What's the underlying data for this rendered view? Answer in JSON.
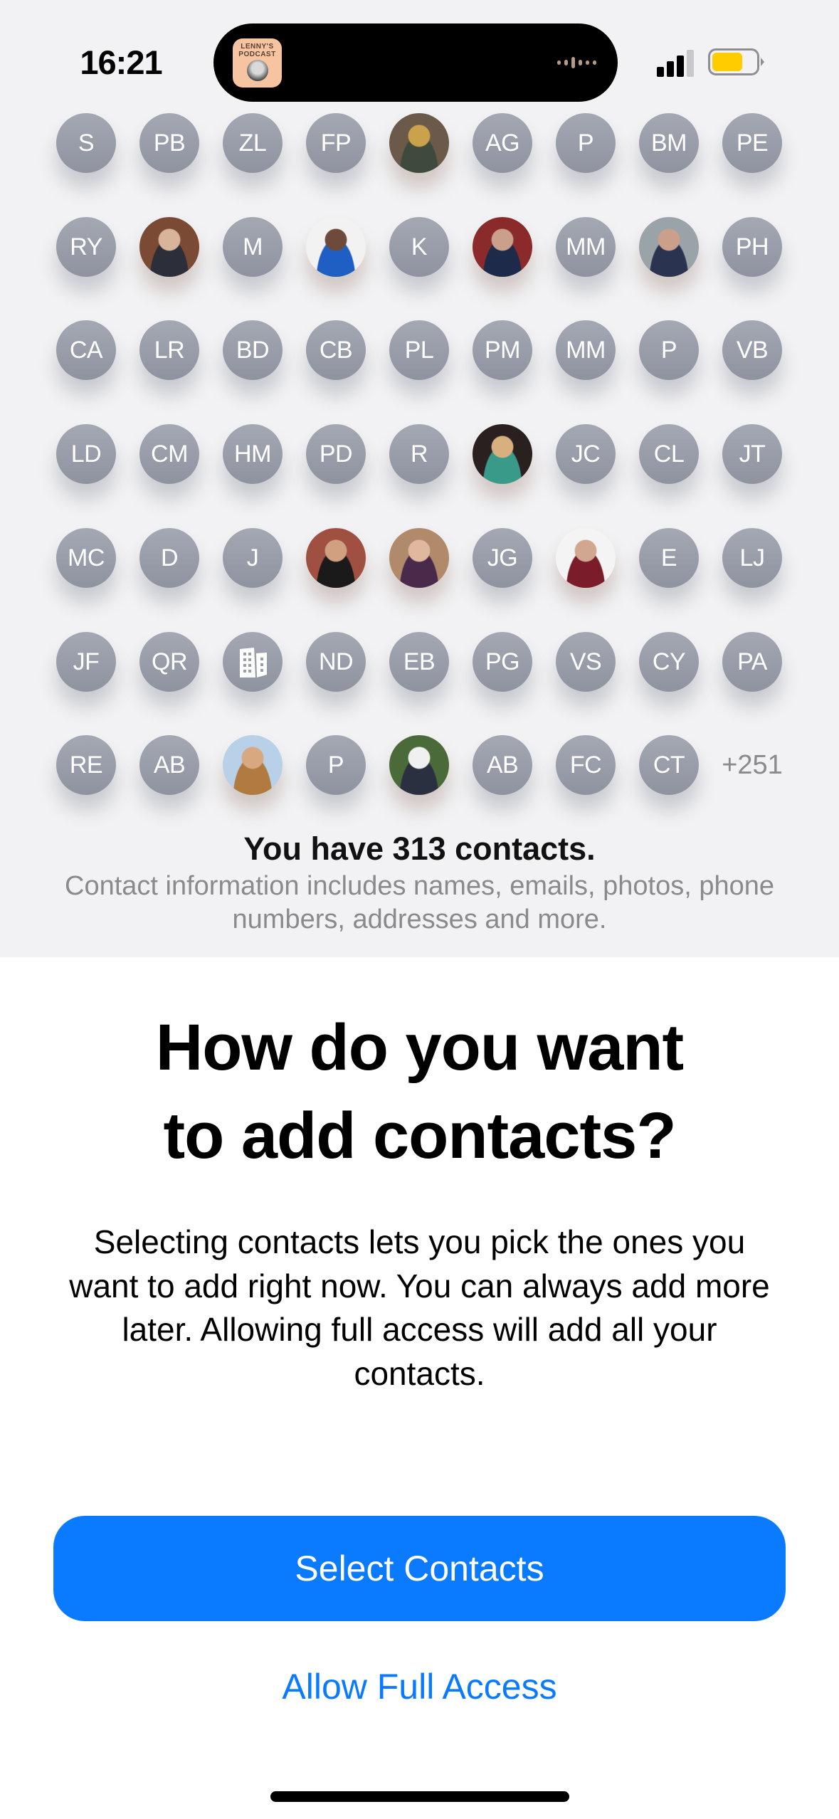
{
  "status_bar": {
    "time": "16:21",
    "now_playing_art_title": "LENNY'S PODCAST",
    "signal_bars_active": 3,
    "signal_bars_total": 4,
    "battery_level_percent": 70,
    "battery_color": "#ffcc00",
    "low_power_mode": true
  },
  "contacts_grid": {
    "rows": [
      [
        {
          "type": "initials",
          "text": "S"
        },
        {
          "type": "initials",
          "text": "PB"
        },
        {
          "type": "initials",
          "text": "ZL"
        },
        {
          "type": "initials",
          "text": "FP"
        },
        {
          "type": "photo",
          "name": "woman-glasses-scarf-photo",
          "colors": [
            "#6b5a4a",
            "#c9a24b",
            "#3e4a3c"
          ]
        },
        {
          "type": "initials",
          "text": "AG"
        },
        {
          "type": "initials",
          "text": "P"
        },
        {
          "type": "initials",
          "text": "BM"
        },
        {
          "type": "initials",
          "text": "PE"
        }
      ],
      [
        {
          "type": "initials",
          "text": "RY"
        },
        {
          "type": "photo",
          "name": "man-surprised-photo",
          "colors": [
            "#7a4a34",
            "#d7b49a",
            "#2c2f3a"
          ]
        },
        {
          "type": "initials",
          "text": "M"
        },
        {
          "type": "photo",
          "name": "woman-blue-shirt-photo",
          "colors": [
            "#f2f2f2",
            "#6d4a3a",
            "#1f5fc4"
          ]
        },
        {
          "type": "initials",
          "text": "K"
        },
        {
          "type": "photo",
          "name": "two-boys-selfie-photo",
          "colors": [
            "#8a2a2a",
            "#caa08a",
            "#1d2a4a"
          ]
        },
        {
          "type": "initials",
          "text": "MM"
        },
        {
          "type": "photo",
          "name": "boy-selfie-photo",
          "colors": [
            "#9aa3a8",
            "#caa08a",
            "#2a3350"
          ]
        },
        {
          "type": "initials",
          "text": "PH"
        }
      ],
      [
        {
          "type": "initials",
          "text": "CA"
        },
        {
          "type": "initials",
          "text": "LR"
        },
        {
          "type": "initials",
          "text": "BD"
        },
        {
          "type": "initials",
          "text": "CB"
        },
        {
          "type": "initials",
          "text": "PL"
        },
        {
          "type": "initials",
          "text": "PM"
        },
        {
          "type": "initials",
          "text": "MM"
        },
        {
          "type": "initials",
          "text": "P"
        },
        {
          "type": "initials",
          "text": "VB"
        }
      ],
      [
        {
          "type": "initials",
          "text": "LD"
        },
        {
          "type": "initials",
          "text": "CM"
        },
        {
          "type": "initials",
          "text": "HM"
        },
        {
          "type": "initials",
          "text": "PD"
        },
        {
          "type": "initials",
          "text": "R"
        },
        {
          "type": "photo",
          "name": "group-selfie-photo",
          "colors": [
            "#2a2020",
            "#d8b080",
            "#3a9a8a"
          ]
        },
        {
          "type": "initials",
          "text": "JC"
        },
        {
          "type": "initials",
          "text": "CL"
        },
        {
          "type": "initials",
          "text": "JT"
        }
      ],
      [
        {
          "type": "initials",
          "text": "MC"
        },
        {
          "type": "initials",
          "text": "D"
        },
        {
          "type": "initials",
          "text": "J"
        },
        {
          "type": "photo",
          "name": "friends-cap-photo",
          "colors": [
            "#a05040",
            "#d0a080",
            "#1a1a1a"
          ]
        },
        {
          "type": "photo",
          "name": "girl-purple-hair-photo",
          "colors": [
            "#b08a6a",
            "#e0b8a0",
            "#4a2a4a"
          ]
        },
        {
          "type": "initials",
          "text": "JG"
        },
        {
          "type": "photo",
          "name": "man-red-sweater-photo",
          "colors": [
            "#f4f4f4",
            "#d0a890",
            "#7a1c2a"
          ]
        },
        {
          "type": "initials",
          "text": "E"
        },
        {
          "type": "initials",
          "text": "LJ"
        }
      ],
      [
        {
          "type": "initials",
          "text": "JF"
        },
        {
          "type": "initials",
          "text": "QR"
        },
        {
          "type": "icon",
          "name": "building-icon"
        },
        {
          "type": "initials",
          "text": "ND"
        },
        {
          "type": "initials",
          "text": "EB"
        },
        {
          "type": "initials",
          "text": "PG"
        },
        {
          "type": "initials",
          "text": "VS"
        },
        {
          "type": "initials",
          "text": "CY"
        },
        {
          "type": "initials",
          "text": "PA"
        }
      ],
      [
        {
          "type": "initials",
          "text": "RE"
        },
        {
          "type": "initials",
          "text": "AB"
        },
        {
          "type": "photo",
          "name": "memoji-glasses-photo",
          "colors": [
            "#b8d0e8",
            "#d8a880",
            "#b07a40"
          ]
        },
        {
          "type": "initials",
          "text": "P"
        },
        {
          "type": "photo",
          "name": "boys-outdoors-photo",
          "colors": [
            "#4a6a3a",
            "#f0f0f0",
            "#2a3040"
          ]
        },
        {
          "type": "initials",
          "text": "AB"
        },
        {
          "type": "initials",
          "text": "FC"
        },
        {
          "type": "initials",
          "text": "CT"
        },
        {
          "type": "more",
          "text": "+251"
        }
      ]
    ]
  },
  "summary": {
    "count_text": "You have 313 contacts.",
    "info_text": "Contact information includes names, emails, photos, phone numbers, addresses and more."
  },
  "prompt": {
    "title_line1": "How do you want",
    "title_line2": "to add contacts?",
    "body": "Selecting contacts lets you pick the ones you want to add right now. You can always add more later. Allowing full access will add all your contacts."
  },
  "actions": {
    "primary_label": "Select Contacts",
    "secondary_label": "Allow Full Access",
    "accent_color": "#0a7aff"
  }
}
